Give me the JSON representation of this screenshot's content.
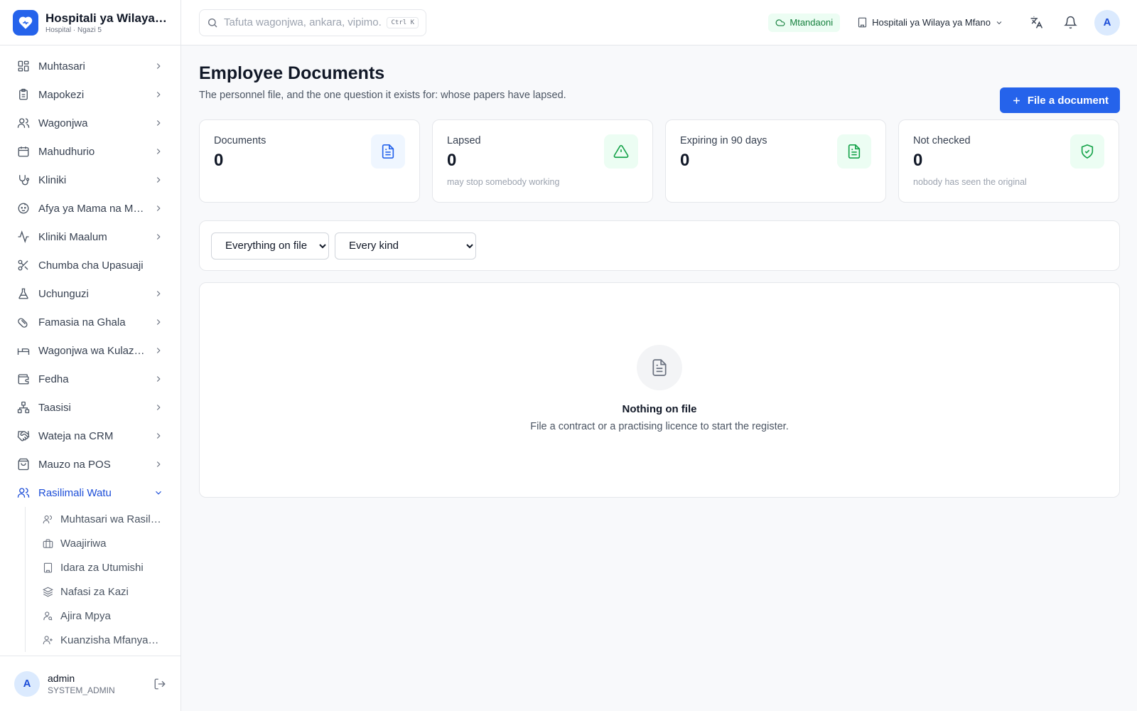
{
  "brand": {
    "name": "Hospitali ya Wilaya ya Mfano",
    "subtitle": "Hospital · Ngazi 5"
  },
  "search": {
    "placeholder": "Tafuta wagonjwa, ankara, vipimo...",
    "shortcut": "Ctrl K"
  },
  "topbar": {
    "status": "Mtandaoni",
    "facility": "Hospitali ya Wilaya ya Mfano",
    "avatar_initial": "A"
  },
  "sidebar": {
    "items": [
      {
        "label": "Muhtasari",
        "icon": "dashboard-icon"
      },
      {
        "label": "Mapokezi",
        "icon": "clipboard-icon"
      },
      {
        "label": "Wagonjwa",
        "icon": "users-icon"
      },
      {
        "label": "Mahudhurio",
        "icon": "calendar-icon"
      },
      {
        "label": "Kliniki",
        "icon": "stethoscope-icon"
      },
      {
        "label": "Afya ya Mama na Mtoto",
        "icon": "baby-icon"
      },
      {
        "label": "Kliniki Maalum",
        "icon": "activity-icon"
      },
      {
        "label": "Chumba cha Upasuaji",
        "icon": "scissors-icon"
      },
      {
        "label": "Uchunguzi",
        "icon": "flask-icon"
      },
      {
        "label": "Famasia na Ghala",
        "icon": "pill-icon"
      },
      {
        "label": "Wagonjwa wa Kulazwa",
        "icon": "bed-icon"
      },
      {
        "label": "Fedha",
        "icon": "wallet-icon"
      },
      {
        "label": "Taasisi",
        "icon": "network-icon"
      },
      {
        "label": "Wateja na CRM",
        "icon": "handshake-icon"
      },
      {
        "label": "Mauzo na POS",
        "icon": "shopping-bag-icon"
      },
      {
        "label": "Rasilimali Watu",
        "icon": "users-icon"
      }
    ],
    "sub_items": [
      {
        "label": "Muhtasari wa Rasilimali Watu"
      },
      {
        "label": "Waajiriwa"
      },
      {
        "label": "Idara za Utumishi"
      },
      {
        "label": "Nafasi za Kazi"
      },
      {
        "label": "Ajira Mpya"
      },
      {
        "label": "Kuanzisha Mfanyakazi"
      }
    ]
  },
  "user": {
    "initial": "A",
    "name": "admin",
    "role": "SYSTEM_ADMIN"
  },
  "page": {
    "title": "Employee Documents",
    "subtitle": "The personnel file, and the one question it exists for: whose papers have lapsed.",
    "primary_action": "File a document"
  },
  "stats": [
    {
      "label": "Documents",
      "value": "0",
      "note": ""
    },
    {
      "label": "Lapsed",
      "value": "0",
      "note": "may stop somebody working"
    },
    {
      "label": "Expiring in 90 days",
      "value": "0",
      "note": ""
    },
    {
      "label": "Not checked",
      "value": "0",
      "note": "nobody has seen the original"
    }
  ],
  "filters": {
    "scope": "Everything on file",
    "kind": "Every kind"
  },
  "empty": {
    "title": "Nothing on file",
    "text": "File a contract or a practising licence to start the register."
  },
  "colors": {
    "accent": "#2563eb",
    "success": "#16a34a"
  }
}
